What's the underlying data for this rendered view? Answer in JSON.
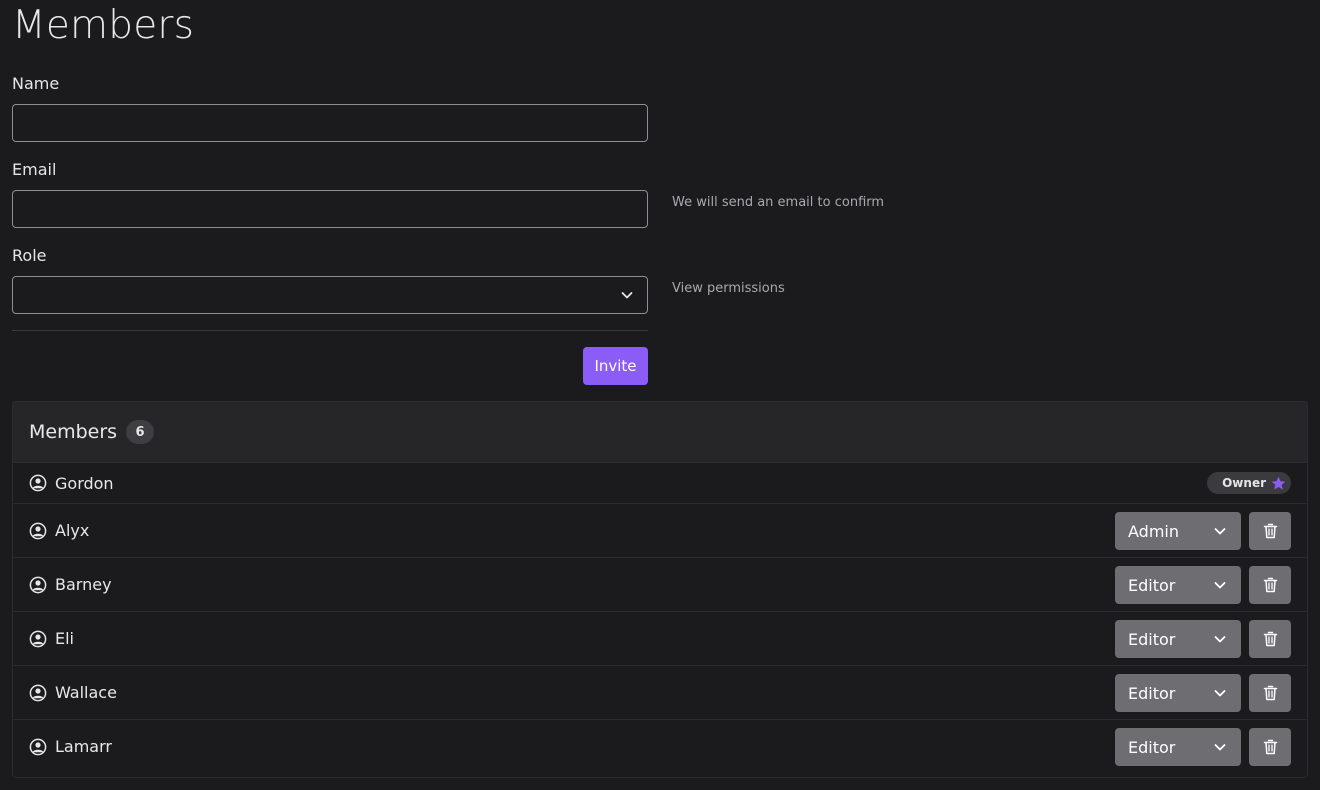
{
  "page": {
    "title": "Members"
  },
  "form": {
    "name_label": "Name",
    "name_value": "",
    "email_label": "Email",
    "email_value": "",
    "email_help": "We will send an email to confirm",
    "role_label": "Role",
    "role_value": "",
    "role_help": "View permissions",
    "invite_label": "Invite"
  },
  "members_card": {
    "title": "Members",
    "count": "6",
    "owner": {
      "name": "Gordon",
      "badge": "Owner",
      "badge_icon": "star-icon"
    },
    "rows": [
      {
        "name": "Alyx",
        "role": "Admin"
      },
      {
        "name": "Barney",
        "role": "Editor"
      },
      {
        "name": "Eli",
        "role": "Editor"
      },
      {
        "name": "Wallace",
        "role": "Editor"
      },
      {
        "name": "Lamarr",
        "role": "Editor"
      }
    ]
  },
  "colors": {
    "background": "#1b1b1d",
    "accent": "#8b5cf6",
    "control_gray": "#6d6d72",
    "card_header": "#262628"
  }
}
